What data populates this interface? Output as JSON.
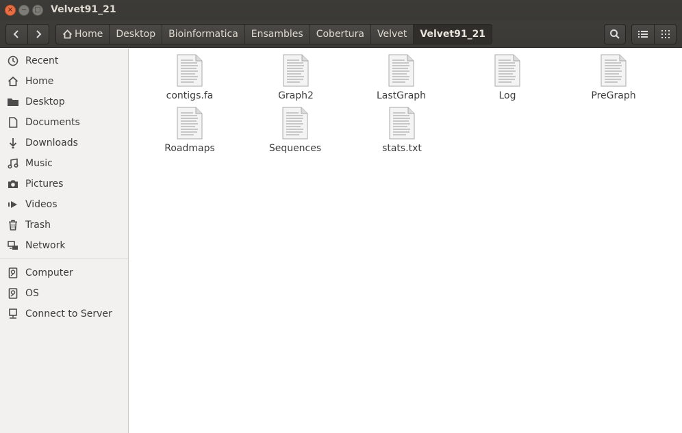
{
  "window": {
    "title": "Velvet91_21",
    "close_glyph": "×",
    "min_glyph": "−",
    "max_glyph": "□"
  },
  "toolbar": {
    "back_icon": "chevron-left-icon",
    "forward_icon": "chevron-right-icon",
    "breadcrumbs": [
      "Home",
      "Desktop",
      "Bioinformatica",
      "Ensambles",
      "Cobertura",
      "Velvet",
      "Velvet91_21"
    ],
    "active_crumb_index": 6,
    "search_icon": "search-icon",
    "list_view_icon": "list-view-icon",
    "grid_view_icon": "grid-view-icon"
  },
  "sidebar": {
    "places": [
      {
        "label": "Recent",
        "icon": "clock-icon"
      },
      {
        "label": "Home",
        "icon": "home-icon"
      },
      {
        "label": "Desktop",
        "icon": "folder-icon"
      },
      {
        "label": "Documents",
        "icon": "document-icon"
      },
      {
        "label": "Downloads",
        "icon": "download-icon"
      },
      {
        "label": "Music",
        "icon": "music-icon"
      },
      {
        "label": "Pictures",
        "icon": "camera-icon"
      },
      {
        "label": "Videos",
        "icon": "video-icon"
      },
      {
        "label": "Trash",
        "icon": "trash-icon"
      },
      {
        "label": "Network",
        "icon": "network-icon"
      }
    ],
    "devices": [
      {
        "label": "Computer",
        "icon": "drive-icon"
      },
      {
        "label": "OS",
        "icon": "drive-icon"
      },
      {
        "label": "Connect to Server",
        "icon": "server-icon"
      }
    ]
  },
  "content": {
    "files": [
      {
        "name": "contigs.fa",
        "icon": "text-file-icon"
      },
      {
        "name": "Graph2",
        "icon": "text-file-icon"
      },
      {
        "name": "LastGraph",
        "icon": "text-file-icon"
      },
      {
        "name": "Log",
        "icon": "text-file-icon"
      },
      {
        "name": "PreGraph",
        "icon": "text-file-icon"
      },
      {
        "name": "Roadmaps",
        "icon": "text-file-icon"
      },
      {
        "name": "Sequences",
        "icon": "text-file-icon"
      },
      {
        "name": "stats.txt",
        "icon": "text-file-icon"
      }
    ]
  }
}
